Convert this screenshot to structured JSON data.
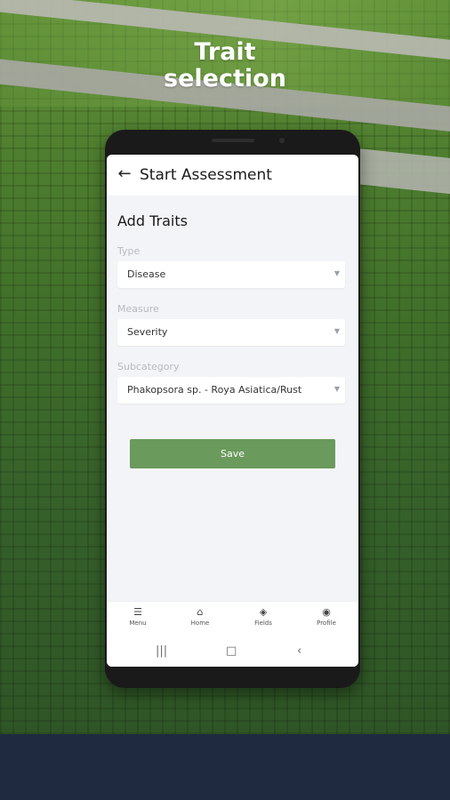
{
  "headline": {
    "line1": "Trait",
    "line2": "selection"
  },
  "app_bar": {
    "back_icon": "back-arrow-icon",
    "title": "Start Assessment"
  },
  "form": {
    "section_title": "Add Traits",
    "fields": [
      {
        "label": "Type",
        "value": "Disease"
      },
      {
        "label": "Measure",
        "value": "Severity"
      },
      {
        "label": "Subcategory",
        "value": "Phakopsora sp. - Roya Asiatica/Rust"
      }
    ],
    "save_label": "Save"
  },
  "bottom_nav": [
    {
      "label": "Menu",
      "icon": "menu-icon"
    },
    {
      "label": "Home",
      "icon": "home-icon"
    },
    {
      "label": "Fields",
      "icon": "layers-icon"
    },
    {
      "label": "Profile",
      "icon": "profile-icon"
    }
  ],
  "colors": {
    "primary_button": "#6a9a5c",
    "footer": "#1f2a40",
    "screen_bg": "#f3f4f8"
  }
}
